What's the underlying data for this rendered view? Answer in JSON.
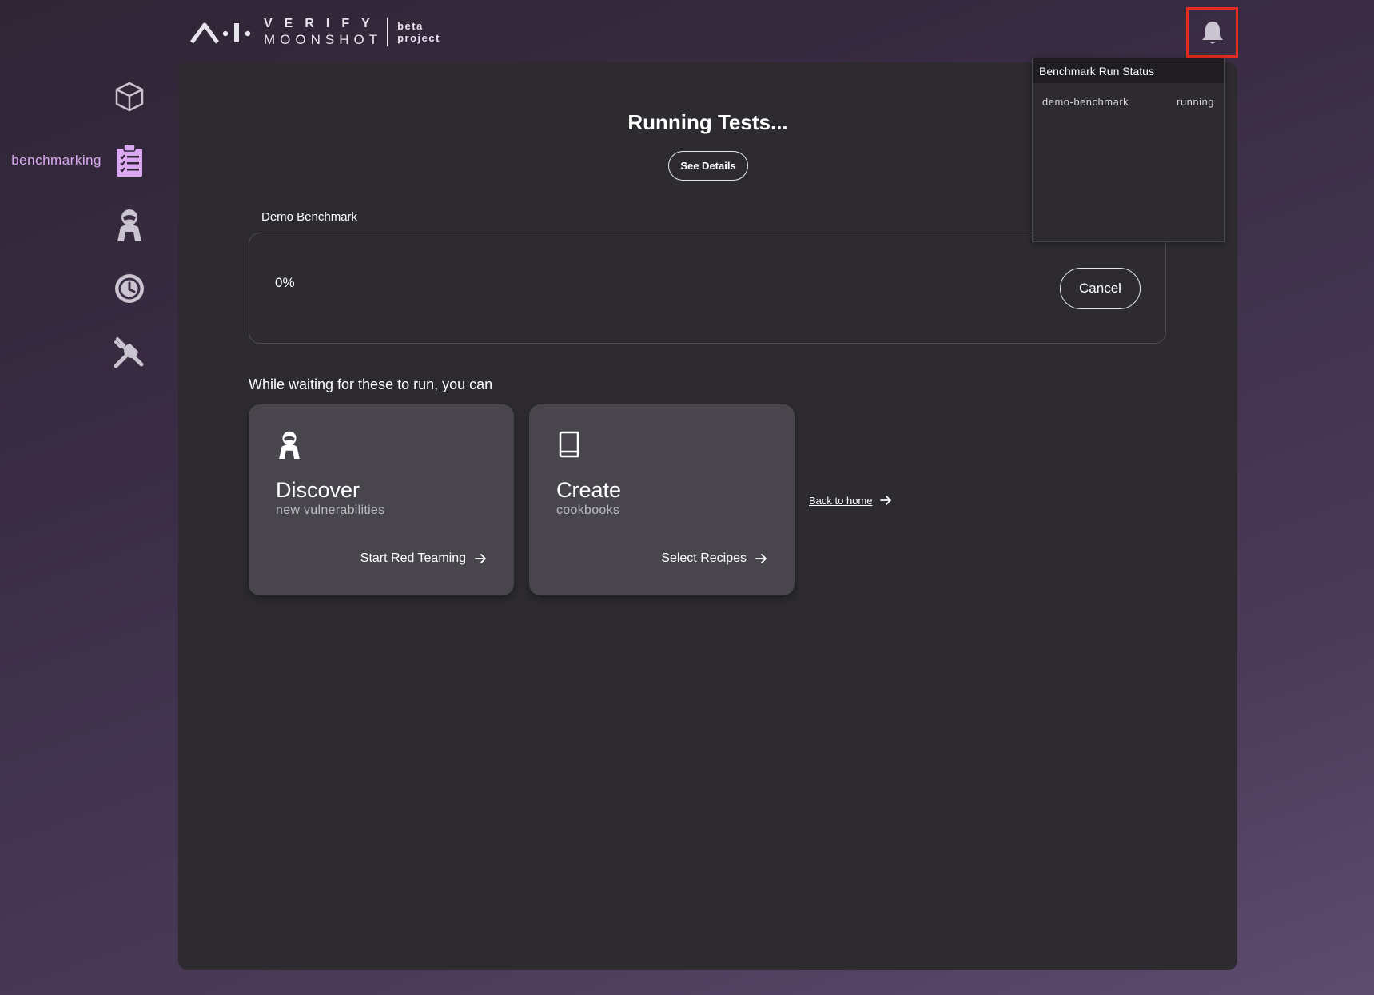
{
  "header": {
    "logo_verify": "VERIFY",
    "logo_moonshot": "MOONSHOT",
    "logo_beta": "beta",
    "logo_project": "project"
  },
  "sidebar": {
    "items": [
      {
        "icon": "cube-icon",
        "label": ""
      },
      {
        "icon": "clipboard-icon",
        "label": "benchmarking",
        "active": true
      },
      {
        "icon": "red-teaming-icon",
        "label": ""
      },
      {
        "icon": "history-icon",
        "label": ""
      },
      {
        "icon": "tools-icon",
        "label": ""
      }
    ],
    "active_color": "#d9a8f0",
    "icon_color": "#c9c4d0"
  },
  "main": {
    "title": "Running Tests...",
    "see_details_label": "See Details",
    "benchmark_name": "Demo Benchmark",
    "progress_text": "0%",
    "progress_value": 0,
    "cancel_label": "Cancel",
    "waiting_text": "While waiting for these to run, you can",
    "cards": [
      {
        "icon": "red-teaming-icon",
        "title": "Discover",
        "subtitle": "new vulnerabilities",
        "action": "Start Red Teaming"
      },
      {
        "icon": "book-icon",
        "title": "Create",
        "subtitle": "cookbooks",
        "action": "Select Recipes"
      }
    ],
    "back_home_label": "Back to home"
  },
  "notifications": {
    "title": "Benchmark Run Status",
    "rows": [
      {
        "name": "demo-benchmark",
        "status": "running"
      }
    ]
  },
  "colors": {
    "highlight_border": "#e32c20",
    "panel_bg": "#2d2b30",
    "card_bg": "#48464c"
  }
}
